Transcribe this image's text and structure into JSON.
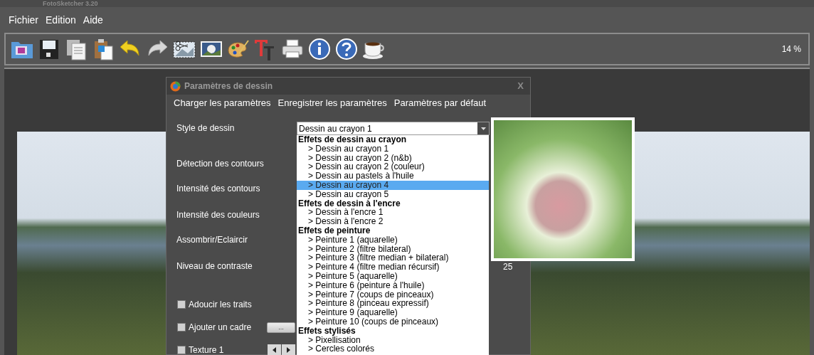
{
  "window": {
    "title": "FotoSketcher 3.20"
  },
  "menu": [
    "Fichier",
    "Edition",
    "Aide"
  ],
  "zoom": "14 %",
  "dialog": {
    "title": "Paramètres de dessin",
    "close": "X",
    "menu": [
      "Charger les paramètres",
      "Enregistrer les paramètres",
      "Paramètres par défaut"
    ],
    "settings": [
      {
        "label": "Style de dessin"
      },
      {
        "label": "Détection des contours"
      },
      {
        "label": "Intensité des contours"
      },
      {
        "label": "Intensité des couleurs"
      },
      {
        "label": "Assombrir/Eclaircir"
      },
      {
        "label": "Niveau de contraste"
      }
    ],
    "style_value": "Dessin au crayon 1",
    "dropdown": [
      {
        "heading": "Effets de dessin au crayon",
        "items": [
          {
            "label": "> Dessin au crayon 1",
            "selected": false
          },
          {
            "label": "> Dessin au crayon 2 (n&b)",
            "selected": false
          },
          {
            "label": "> Dessin au crayon 2 (couleur)",
            "selected": false
          },
          {
            "label": "> Dessin au pastels à l'huile",
            "selected": false
          },
          {
            "label": "> Dessin au crayon 4",
            "selected": true
          },
          {
            "label": "> Dessin au crayon 5",
            "selected": false
          }
        ]
      },
      {
        "heading": "Effets de dessin à l'encre",
        "items": [
          {
            "label": "> Dessin à l'encre 1",
            "selected": false
          },
          {
            "label": "> Dessin à l'encre 2",
            "selected": false
          }
        ]
      },
      {
        "heading": "Effets de peinture",
        "items": [
          {
            "label": "> Peinture 1 (aquarelle)",
            "selected": false
          },
          {
            "label": "> Peinture 2 (filtre bilateral)",
            "selected": false
          },
          {
            "label": "> Peinture 3 (filtre median + bilateral)",
            "selected": false
          },
          {
            "label": "> Peinture 4 (filtre median récursif)",
            "selected": false
          },
          {
            "label": "> Peinture 5 (aquarelle)",
            "selected": false
          },
          {
            "label": "> Peinture 6 (peinture à l'huile)",
            "selected": false
          },
          {
            "label": "> Peinture 7 (coups de pinceaux)",
            "selected": false
          },
          {
            "label": "> Peinture 8 (pinceau expressif)",
            "selected": false
          },
          {
            "label": "> Peinture 9 (aquarelle)",
            "selected": false
          },
          {
            "label": "> Peinture 10 (coups de pinceaux)",
            "selected": false
          }
        ]
      },
      {
        "heading": "Effets stylisés",
        "items": [
          {
            "label": "> Pixellisation",
            "selected": false
          },
          {
            "label": "> Cercles colorés",
            "selected": false
          }
        ]
      }
    ],
    "preview_value": "25",
    "checkboxes": [
      {
        "label": "Adoucir les traits",
        "checked": false,
        "kind": "plain"
      },
      {
        "label": "Ajouter un cadre",
        "checked": false,
        "kind": "button",
        "button": "..."
      },
      {
        "label": "Texture 1",
        "checked": false,
        "kind": "arrows"
      }
    ]
  }
}
